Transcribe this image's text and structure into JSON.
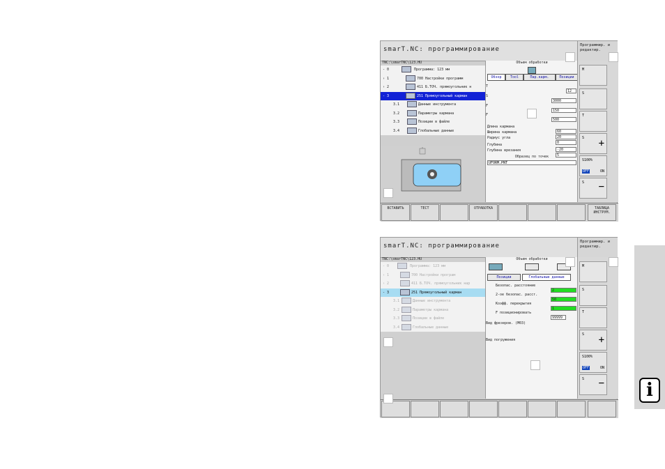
{
  "screen1": {
    "title": "smarT.NC: программирование",
    "mode": "Программир. и редактир.",
    "path": "TNC:\\smarTNC\\123.HU",
    "tree": [
      {
        "num": "- 0",
        "text": "Программа: 123 мм"
      },
      {
        "num": "› 1",
        "text": "700 Настройки программ"
      },
      {
        "num": "› 2",
        "text": "411 Б.ТОЧ. прямоугольник н"
      },
      {
        "num": "- 3",
        "text": "251 Прямоугольный карман"
      },
      {
        "num": "3.1",
        "text": "Данные инструмента"
      },
      {
        "num": "3.2",
        "text": "Параметры кармана"
      },
      {
        "num": "3.3",
        "text": "Позиции в файле"
      },
      {
        "num": "3.4",
        "text": "Глобальные данные"
      }
    ],
    "form_title": "Объем обработки",
    "tabs": [
      "Обзор",
      "Tool",
      "Пар.карм.",
      "Позиции"
    ],
    "fields": [
      {
        "label": "T",
        "value": "12"
      },
      {
        "label": "S",
        "value": "3000"
      },
      {
        "label": "F",
        "value": "150"
      },
      {
        "label": "F",
        "value": "500"
      },
      {
        "label": "Длина кармана",
        "value": "60"
      },
      {
        "label": "Ширина кармана",
        "value": "20"
      },
      {
        "label": "Радиус угла",
        "value": "0"
      },
      {
        "label": "Глубина",
        "value": "-20"
      },
      {
        "label": "Глубина врезания",
        "value": "5"
      }
    ],
    "pattern_label": "Образец по точек",
    "pattern_file": "UFORM.PNT",
    "side": [
      "M",
      "S",
      "T",
      "S",
      "S100%",
      "S"
    ],
    "side_off_on": [
      "OFF",
      "ON"
    ],
    "softkeys": [
      "ВСТАВИТЬ",
      "ТЕСТ",
      "",
      "ОТРАБОТКА",
      "",
      "",
      "",
      "ТАБЛИЦА ИНСТРУМ."
    ]
  },
  "screen2": {
    "title": "smarT.NC: программирование",
    "mode": "Программир. и редактир.",
    "path": "TNC:\\smarTNC\\123.HU",
    "tree": [
      {
        "num": "- 0",
        "text": "Программа: 123 мм"
      },
      {
        "num": "› 1",
        "text": "700 Настройки програм"
      },
      {
        "num": "› 2",
        "text": "411 Б.ТОЧ. прямоугольник нар"
      },
      {
        "num": "- 3",
        "text": "251 Прямоугольный карман"
      },
      {
        "num": "3.1",
        "text": "Данные инструмента"
      },
      {
        "num": "3.2",
        "text": "Параметры кармана"
      },
      {
        "num": "3.3",
        "text": "Позиции в файле"
      },
      {
        "num": "3.4",
        "text": "Глобальные данные"
      }
    ],
    "form_title": "Объем обработки",
    "tabs": [
      "Позиции",
      "Глобальные данные"
    ],
    "fields": [
      {
        "label": "Безопас. расстояние",
        "value": "2"
      },
      {
        "label": "2-ое безопас. расст.",
        "value": "50"
      },
      {
        "label": "Коэфф. перекрытия",
        "value": "1"
      },
      {
        "label": "F позиционировать",
        "value": "99999"
      }
    ],
    "mill_label": "Вид фрезеров. (M03)",
    "plunge_label": "Вид погружения",
    "side": [
      "M",
      "S",
      "T",
      "S",
      "S100%",
      "S"
    ],
    "side_off_on": [
      "OFF",
      "ON"
    ]
  },
  "info_icon": "info-icon",
  "info_glyph": "i"
}
